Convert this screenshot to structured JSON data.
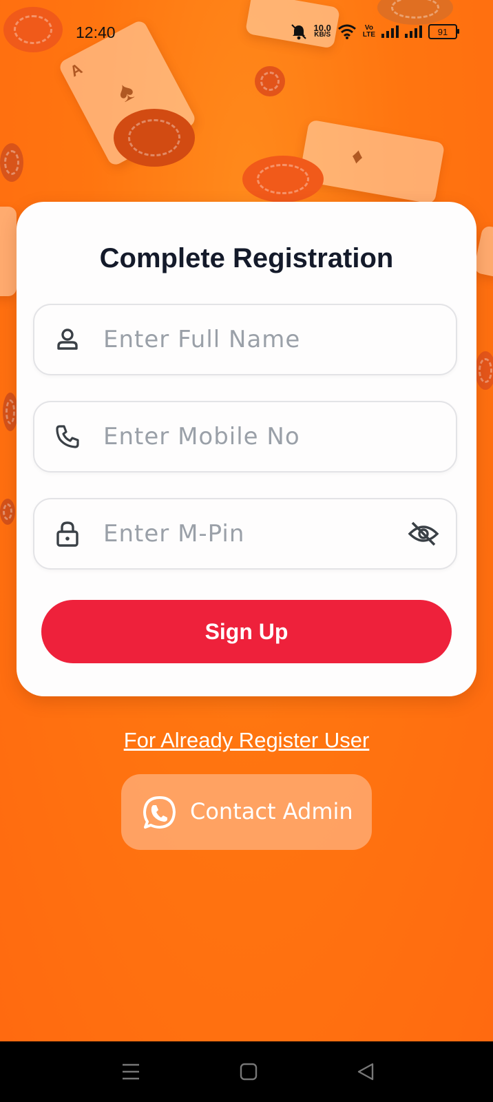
{
  "status_bar": {
    "time": "12:40",
    "net_speed_value": "10.0",
    "net_speed_unit": "KB/S",
    "volte_top": "Vo",
    "volte_bottom": "LTE",
    "battery": "91"
  },
  "registration": {
    "title": "Complete Registration",
    "name_placeholder": "Enter Full Name",
    "mobile_placeholder": "Enter Mobile No",
    "mpin_placeholder": "Enter M-Pin",
    "signup_label": "Sign Up"
  },
  "login_link": "For Already Register User",
  "contact_admin_label": "Contact Admin",
  "colors": {
    "background": "#ff7510",
    "accent_button": "#ee213b",
    "card": "#fefdfd",
    "title": "#141a2a"
  },
  "icons": {
    "name_field": "user-icon",
    "mobile_field": "phone-icon",
    "mpin_field": "lock-icon",
    "visibility": "eye-off-icon",
    "contact": "whatsapp-icon",
    "nav": [
      "menu-icon",
      "home-square-icon",
      "back-triangle-icon"
    ]
  }
}
